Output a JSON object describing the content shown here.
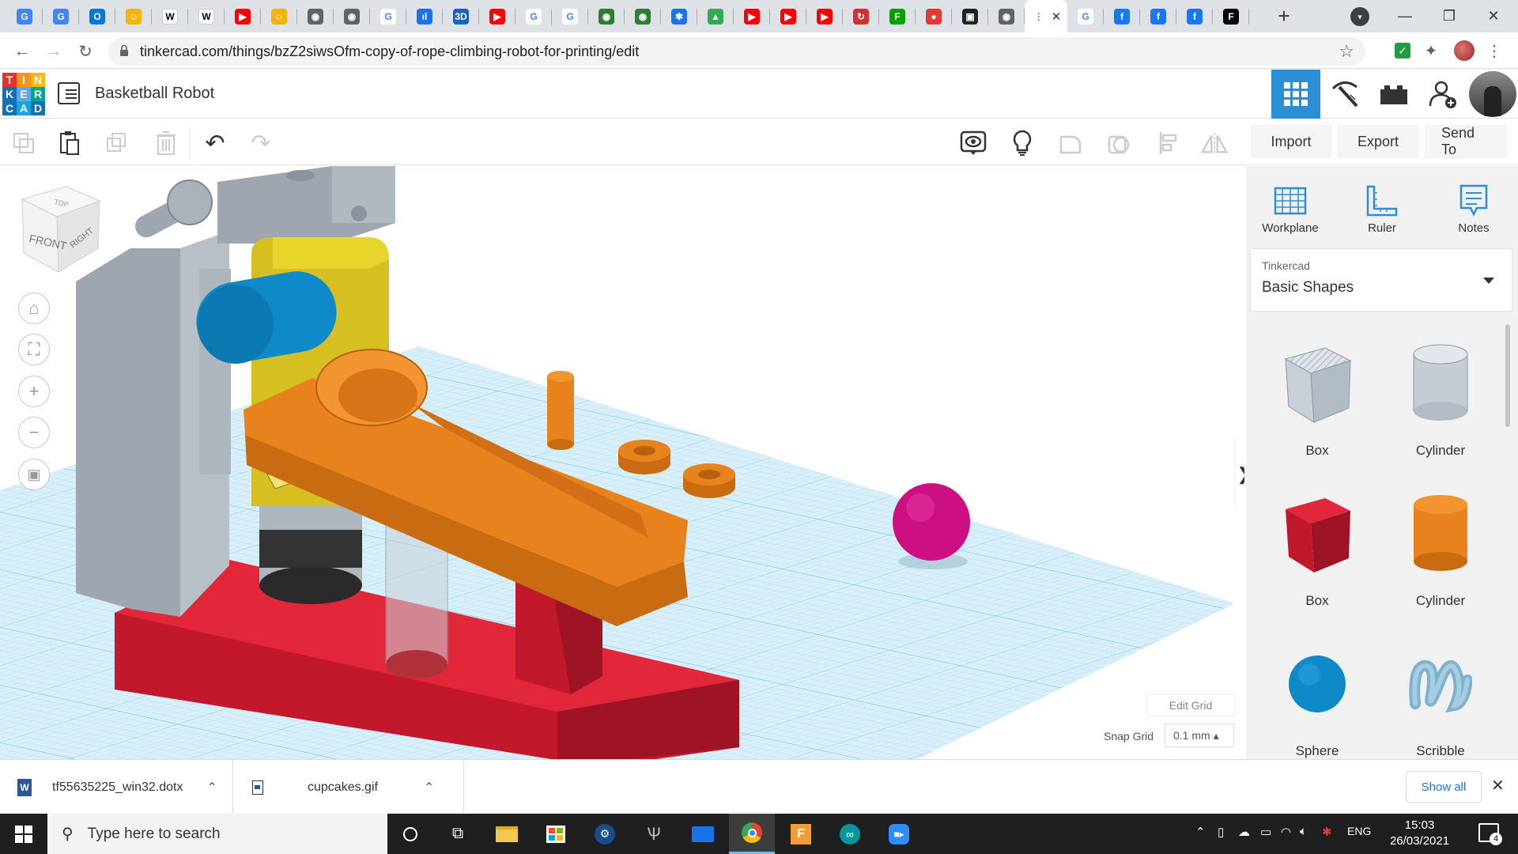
{
  "browser": {
    "tabs": [
      {
        "icon": "google-docs-icon",
        "color": "#4285f4",
        "glyph": "G"
      },
      {
        "icon": "google-docs-icon",
        "color": "#4285f4",
        "glyph": "G"
      },
      {
        "icon": "outlook-icon",
        "color": "#0078d4",
        "glyph": "O"
      },
      {
        "icon": "avatar-icon",
        "color": "#f4b400",
        "glyph": "☺"
      },
      {
        "icon": "wikipedia-icon",
        "color": "#ffffff",
        "glyph": "W"
      },
      {
        "icon": "wikipedia-icon",
        "color": "#ffffff",
        "glyph": "W"
      },
      {
        "icon": "youtube-icon",
        "color": "#ff0000",
        "glyph": "▶"
      },
      {
        "icon": "avatar-icon",
        "color": "#f4b400",
        "glyph": "☺"
      },
      {
        "icon": "globe-icon",
        "color": "#5f6368",
        "glyph": "◉"
      },
      {
        "icon": "globe-icon",
        "color": "#5f6368",
        "glyph": "◉"
      },
      {
        "icon": "google-icon",
        "color": "#ffffff",
        "glyph": "G"
      },
      {
        "icon": "audio-icon",
        "color": "#1a73e8",
        "glyph": "ıl"
      },
      {
        "icon": "3d-icon",
        "color": "#1565c0",
        "glyph": "3D"
      },
      {
        "icon": "youtube-icon",
        "color": "#ff0000",
        "glyph": "▶"
      },
      {
        "icon": "google-icon",
        "color": "#ffffff",
        "glyph": "G"
      },
      {
        "icon": "google-icon",
        "color": "#ffffff",
        "glyph": "G"
      },
      {
        "icon": "badge-icon",
        "color": "#2e7d32",
        "glyph": "◉"
      },
      {
        "icon": "badge-icon",
        "color": "#2e7d32",
        "glyph": "◉"
      },
      {
        "icon": "gear-icon",
        "color": "#1a73e8",
        "glyph": "✱"
      },
      {
        "icon": "google-drive-icon",
        "color": "#34a853",
        "glyph": "▲"
      },
      {
        "icon": "youtube-icon",
        "color": "#ff0000",
        "glyph": "▶"
      },
      {
        "icon": "youtube-icon",
        "color": "#ff0000",
        "glyph": "▶"
      },
      {
        "icon": "youtube-icon",
        "color": "#ff0000",
        "glyph": "▶"
      },
      {
        "icon": "circle-red-icon",
        "color": "#d32f2f",
        "glyph": "↻"
      },
      {
        "icon": "f-green-icon",
        "color": "#00a000",
        "glyph": "F"
      },
      {
        "icon": "tomato-icon",
        "color": "#e53935",
        "glyph": "●"
      },
      {
        "icon": "bookmark-icon",
        "color": "#222222",
        "glyph": "▣"
      },
      {
        "icon": "globe-icon",
        "color": "#5f6368",
        "glyph": "◉"
      },
      {
        "icon": "tinkercad-icon",
        "color": "#ffffff",
        "glyph": "⋮",
        "active": true
      },
      {
        "icon": "google-icon",
        "color": "#ffffff",
        "glyph": "G"
      },
      {
        "icon": "facebook-icon",
        "color": "#1877f2",
        "glyph": "f"
      },
      {
        "icon": "facebook-icon",
        "color": "#1877f2",
        "glyph": "f"
      },
      {
        "icon": "facebook-icon",
        "color": "#1877f2",
        "glyph": "f"
      },
      {
        "icon": "f-black-icon",
        "color": "#000000",
        "glyph": "F"
      }
    ],
    "active_tab_close": "✕",
    "url": "tinkercad.com/things/bzZ2siwsOfm-copy-of-rope-climbing-robot-for-printing/edit"
  },
  "tinkercad": {
    "logo_letters": [
      "T",
      "I",
      "N",
      "K",
      "E",
      "R",
      "C",
      "A",
      "D"
    ],
    "logo_colors": [
      "#e4312b",
      "#f7941d",
      "#fcb814",
      "#0e72b5",
      "#5aa9e6",
      "#00a78e",
      "#0e72b5",
      "#1aa5dd",
      "#0e72b5"
    ],
    "project_title": "Basketball Robot",
    "toolbar": {
      "import": "Import",
      "export": "Export",
      "send_to": "Send To"
    },
    "panel": {
      "tools": [
        "Workplane",
        "Ruler",
        "Notes"
      ],
      "library_sub": "Tinkercad",
      "library_name": "Basic Shapes",
      "shapes": [
        {
          "label": "Box",
          "kind": "box-hole"
        },
        {
          "label": "Cylinder",
          "kind": "cylinder-hole"
        },
        {
          "label": "Box",
          "kind": "box-red"
        },
        {
          "label": "Cylinder",
          "kind": "cylinder-orange"
        },
        {
          "label": "Sphere",
          "kind": "sphere-blue"
        },
        {
          "label": "Scribble",
          "kind": "scribble"
        }
      ]
    },
    "viewcube": {
      "front": "FRONT",
      "right": "RIGHT",
      "top": "TOP"
    },
    "edit_grid": "Edit Grid",
    "snap_grid_label": "Snap Grid",
    "snap_grid_value": "0.1 mm ▴",
    "collapse_glyph": "❯"
  },
  "downloads": [
    {
      "name": "tf55635225_win32.dotx",
      "icon": "word-icon"
    },
    {
      "name": "cupcakes.gif",
      "icon": "file-icon"
    }
  ],
  "downloads_show_all": "Show all",
  "taskbar": {
    "search_placeholder": "Type here to search",
    "language": "ENG",
    "time": "15:03",
    "date": "26/03/2021",
    "notification_count": "4"
  }
}
